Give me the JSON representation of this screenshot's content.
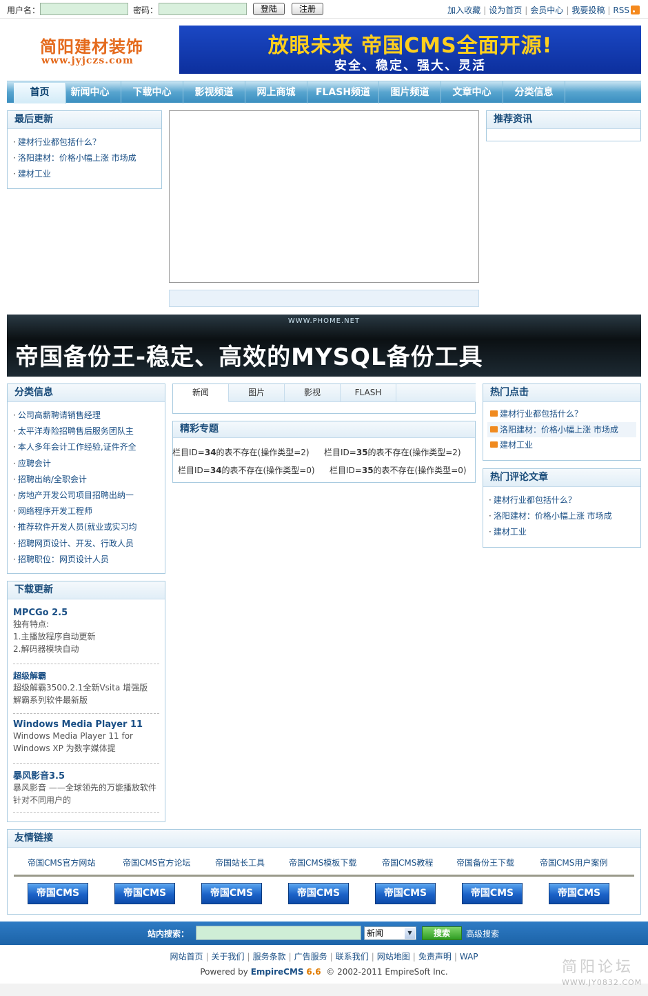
{
  "topbar": {
    "username_label": "用户名：",
    "password_label": "密码：",
    "login_button": "登陆",
    "register_button": "注册",
    "links": [
      "加入收藏",
      "设为首页",
      "会员中心",
      "我要投稿",
      "RSS"
    ]
  },
  "logo": {
    "title": "简阳建材装饰",
    "url": "www.jyjczs.com"
  },
  "banner": {
    "headline": "放眼未来 帝国CMS全面开源!",
    "subline": "安全、稳定、强大、灵活"
  },
  "nav": [
    "首页",
    "新闻中心",
    "下载中心",
    "影视频道",
    "网上商城",
    "FLASH频道",
    "图片频道",
    "文章中心",
    "分类信息"
  ],
  "latest": {
    "title": "最后更新",
    "items": [
      "建材行业都包括什么？",
      "洛阳建材：价格小幅上涨 市场成",
      "建材工业"
    ]
  },
  "recommend": {
    "title": "推荐资讯"
  },
  "ad2": {
    "url": "WWW.PHOME.NET",
    "text": "帝国备份王-稳定、高效的MYSQL备份工具"
  },
  "classified": {
    "title": "分类信息",
    "items": [
      "公司高薪聘请销售经理",
      "太平洋寿险招聘售后服务团队主",
      "本人多年会计工作经验,证件齐全",
      "应聘会计",
      "招聘出纳/全职会计",
      "房地产开发公司项目招聘出纳一",
      "网络程序开发工程师",
      "推荐软件开发人员(就业或实习均",
      "招聘网页设计、开发、行政人员",
      "招聘职位：网页设计人员"
    ]
  },
  "tabs": [
    "新闻",
    "图片",
    "影视",
    "FLASH"
  ],
  "topics": {
    "title": "精彩专题",
    "rows": [
      [
        "栏目ID=",
        "34",
        "的表不存在(操作类型=2)",
        "栏目ID=",
        "35",
        "的表不存在(操作类型=2)"
      ],
      [
        "栏目ID=",
        "34",
        "的表不存在(操作类型=0)",
        "栏目ID=",
        "35",
        "的表不存在(操作类型=0)"
      ]
    ]
  },
  "hot": {
    "title": "热门点击",
    "items": [
      "建材行业都包括什么？",
      "洛阳建材：价格小幅上涨 市场成",
      "建材工业"
    ]
  },
  "hotcomments": {
    "title": "热门评论文章",
    "items": [
      "建材行业都包括什么？",
      "洛阳建材：价格小幅上涨 市场成",
      "建材工业"
    ]
  },
  "downloads": {
    "title": "下载更新",
    "items": [
      {
        "name": "MPCGo 2.5",
        "desc": [
          "独有特点:",
          "1.主播放程序自动更新",
          "2.解码器模块自动"
        ]
      },
      {
        "name": "超级解霸",
        "desc": [
          "超级解霸3500.2.1全新Vsita 增强版",
          "解霸系列软件最新版"
        ]
      },
      {
        "name": "Windows Media Player 11",
        "desc": [
          "Windows Media Player 11 for",
          "Windows XP 为数字媒体提"
        ]
      },
      {
        "name": "暴风影音3.5",
        "desc": [
          "暴风影音 ——全球领先的万能播放软件",
          "针对不同用户的"
        ]
      }
    ]
  },
  "friendlinks": {
    "title": "友情链接",
    "text_links": [
      "帝国CMS官方网站",
      "帝国CMS官方论坛",
      "帝国站长工具",
      "帝国CMS模板下载",
      "帝国CMS教程",
      "帝国备份王下载",
      "帝国CMS用户案例"
    ],
    "logo_label": "帝国CMS"
  },
  "search": {
    "label": "站内搜索：",
    "select_value": "新闻",
    "button": "搜索",
    "advanced": "高级搜索"
  },
  "footer": {
    "links": [
      "网站首页",
      "关于我们",
      "服务条款",
      "广告服务",
      "联系我们",
      "网站地图",
      "免责声明",
      "WAP"
    ],
    "powered_prefix": "Powered by ",
    "brand": "EmpireCMS",
    "version": "6.6",
    "copyright": "© 2002-2011 EmpireSoft Inc."
  },
  "watermark": {
    "cn": "简阳论坛",
    "url": "WWW.JY0832.COM"
  }
}
